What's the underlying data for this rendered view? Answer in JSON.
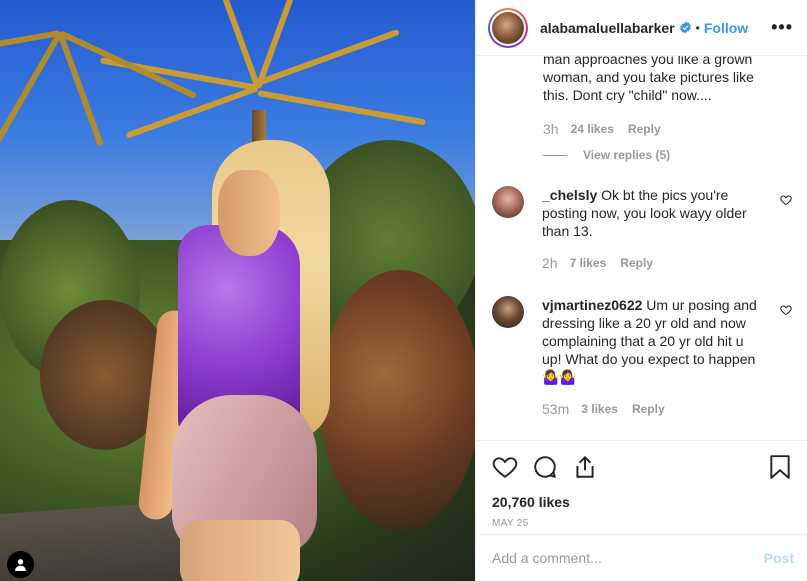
{
  "header": {
    "username": "alabamaluellabarker",
    "separator": "•",
    "follow_label": "Follow",
    "more_label": "•••"
  },
  "partial_comment": {
    "text": "man approaches you like a grown woman, and you take pictures like this. Dont cry \"child\" now....",
    "time": "3h",
    "likes": "24 likes",
    "reply": "Reply",
    "view_replies": "View replies (5)"
  },
  "comments": [
    {
      "user": "_chelsly",
      "text": "Ok bt the pics you're posting now, you look wayy older than 13.",
      "time": "2h",
      "likes": "7 likes",
      "reply": "Reply"
    },
    {
      "user": "vjmartinez0622",
      "text": "Um ur posing and dressing like a 20 yr old and now complaining that a 20 yr old hit u up! What do you expect to happen🤷‍♀️🤷‍♀️",
      "time": "53m",
      "likes": "3 likes",
      "reply": "Reply"
    }
  ],
  "post": {
    "likes": "20,760 likes",
    "date": "MAY 25"
  },
  "composer": {
    "placeholder": "Add a comment...",
    "post_label": "Post"
  },
  "colors": {
    "link": "#3897f0",
    "muted": "#999999",
    "post_disabled": "#b2dffc",
    "verified": "#3897f0"
  },
  "icons": [
    "user-icon",
    "verified-badge-icon",
    "more-icon",
    "heart-icon",
    "comment-icon",
    "share-icon",
    "bookmark-icon"
  ]
}
